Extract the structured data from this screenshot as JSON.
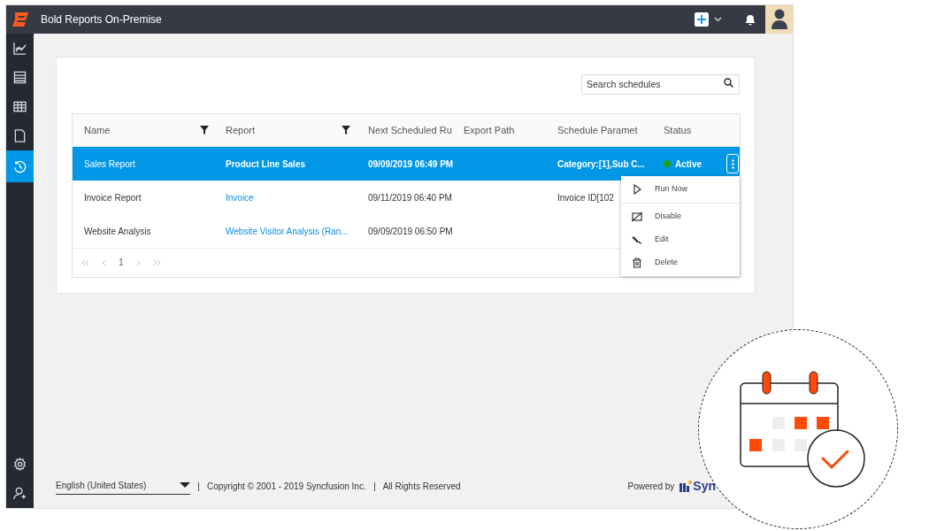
{
  "app": {
    "title": "Bold Reports On-Premise"
  },
  "sidebar": {
    "items": [
      {
        "kind": "chart",
        "selected": false
      },
      {
        "kind": "list",
        "selected": false
      },
      {
        "kind": "table",
        "selected": false
      },
      {
        "kind": "file",
        "selected": false
      },
      {
        "kind": "history",
        "selected": true
      }
    ],
    "bottom": [
      {
        "kind": "settings",
        "selected": false
      },
      {
        "kind": "user",
        "selected": false
      }
    ]
  },
  "search": {
    "placeholder": "Search schedules"
  },
  "table": {
    "columns": [
      {
        "label": "Name",
        "filter": true
      },
      {
        "label": "Report",
        "filter": true
      },
      {
        "label": "Next Scheduled Ru",
        "filter": false
      },
      {
        "label": "Export Path",
        "filter": false
      },
      {
        "label": "Schedule Paramet",
        "filter": false
      },
      {
        "label": "Status",
        "filter": false
      }
    ],
    "rows": [
      {
        "name": "Sales Report",
        "report": "Product Line Sales",
        "next_run": "09/09/2019 06:49 PM",
        "parameters": "Category:[1],Sub C...",
        "status": "Active",
        "selected": true
      },
      {
        "name": "Invoice Report",
        "report": "Invoice",
        "next_run": "09/11/2019 06:40 PM",
        "parameters": "Invoice ID[102",
        "selected": false
      },
      {
        "name": "Website Analysis",
        "report": "Website Visitor Analysis (Ran...",
        "next_run": "09/09/2019 06:50 PM",
        "selected": false
      }
    ],
    "pager": {
      "page": "1"
    }
  },
  "menu": {
    "items": [
      {
        "kind": "run",
        "label": "Run Now"
      },
      {
        "kind": "disable",
        "label": "Disable"
      },
      {
        "kind": "edit",
        "label": "Edit"
      },
      {
        "kind": "delete",
        "label": "Delete"
      }
    ]
  },
  "footer": {
    "language": "English (United States)",
    "copyright": "Copyright © 2001 - 2019 Syncfusion Inc.",
    "rights": "All Rights Reserved",
    "powered_by": "Powered by",
    "logo_text": "Syn"
  }
}
